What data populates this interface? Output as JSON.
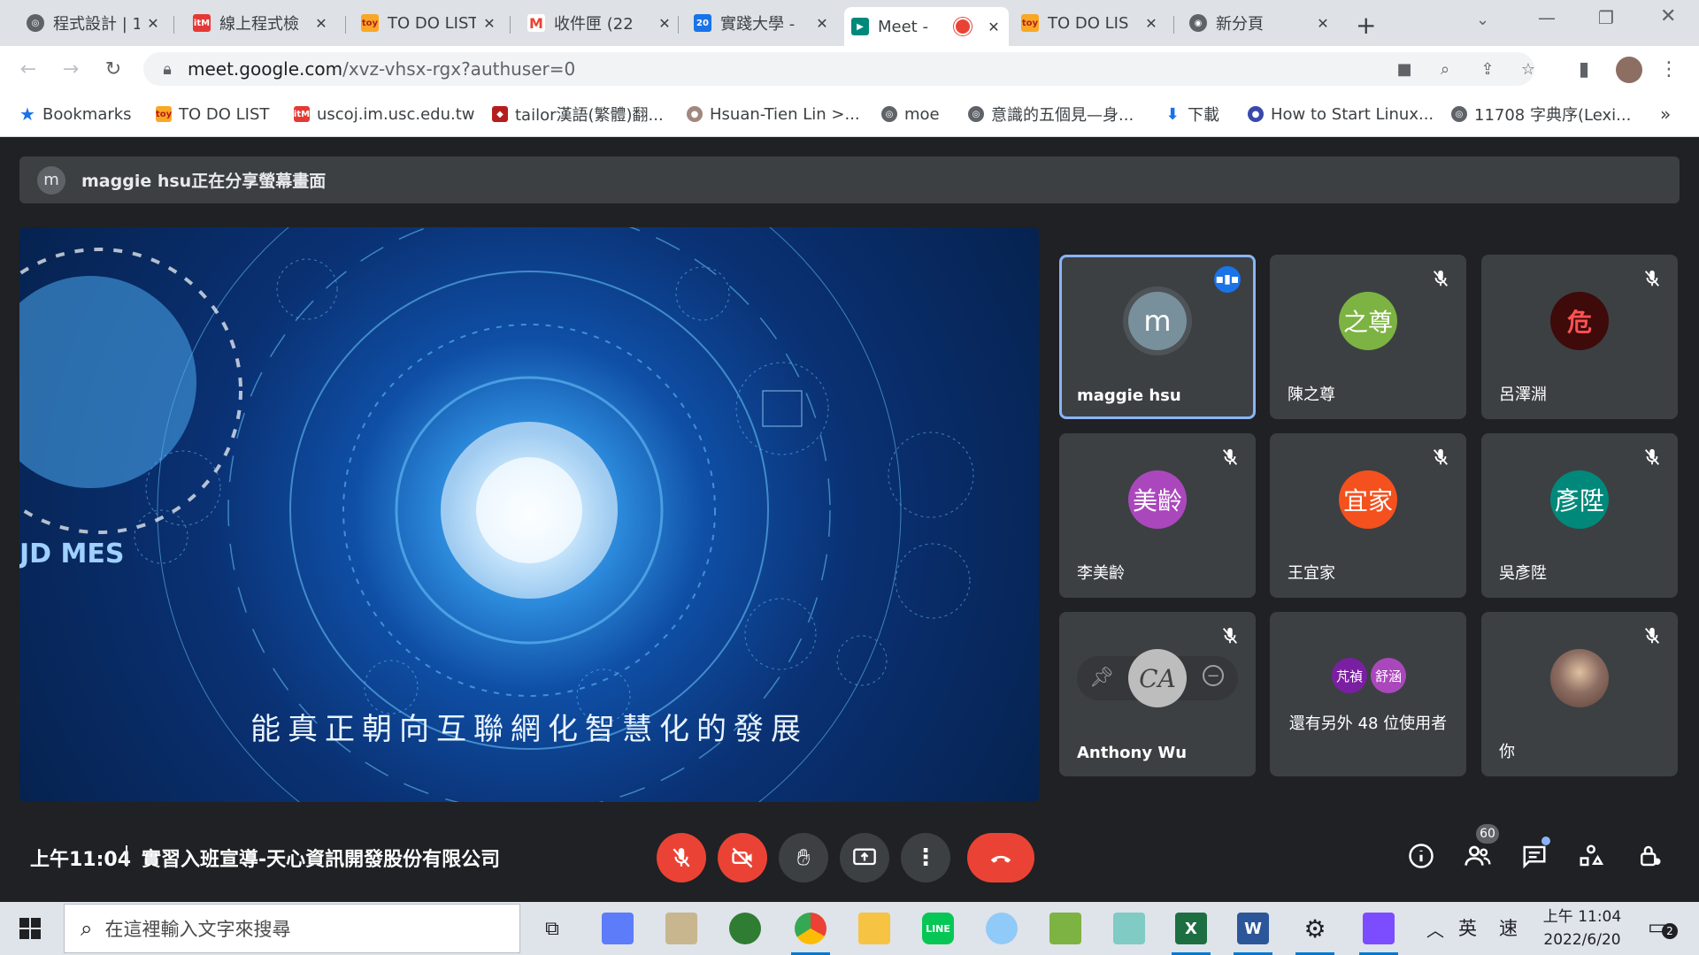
{
  "browser": {
    "tabs": [
      {
        "title": "程式設計 | 1",
        "icon": "globe-icon"
      },
      {
        "title": "線上程式檢",
        "icon": "itm-icon"
      },
      {
        "title": "TO DO LIST",
        "icon": "todo-icon"
      },
      {
        "title": "收件匣 (22",
        "icon": "gmail-icon"
      },
      {
        "title": "實踐大學 -",
        "icon": "calendar-icon"
      },
      {
        "title": "Meet -",
        "icon": "meet-icon"
      },
      {
        "title": "TO DO LIS",
        "icon": "todo-icon"
      },
      {
        "title": "新分頁",
        "icon": "chrome-icon"
      }
    ],
    "url_host": "meet.google.com",
    "url_path": "/xvz-vhsx-rgx?authuser=0",
    "bookmarks": [
      {
        "label": "Bookmarks"
      },
      {
        "label": "TO DO LIST"
      },
      {
        "label": "uscoj.im.usc.edu.tw"
      },
      {
        "label": "tailor漢語(繁體)翻..."
      },
      {
        "label": "Hsuan-Tien Lin >..."
      },
      {
        "label": "moe"
      },
      {
        "label": "意識的五個見—身..."
      },
      {
        "label": "下載"
      },
      {
        "label": "How to Start Linux..."
      },
      {
        "label": "11708 字典序(Lexi..."
      }
    ]
  },
  "meet": {
    "banner_avatar": "m",
    "banner_text": "maggie hsu正在分享螢幕畫面",
    "presentation_subtitle": "能真正朝向互聯網化智慧化的發展",
    "presentation_brand": "JD MES",
    "participants": [
      {
        "name": "maggie hsu",
        "initial": "m",
        "color": "#78909c",
        "speaking": true
      },
      {
        "name": "陳之尊",
        "initial": "之尊",
        "color": "#7cb342",
        "muted": true
      },
      {
        "name": "呂澤淵",
        "initial": "危",
        "color": "#b71c1c",
        "muted": true
      },
      {
        "name": "李美齡",
        "initial": "美齡",
        "color": "#ab47bc",
        "muted": true
      },
      {
        "name": "王宜家",
        "initial": "宜家",
        "color": "#f4511e",
        "muted": true
      },
      {
        "name": "吳彥陞",
        "initial": "彥陞",
        "color": "#00897b",
        "muted": true
      },
      {
        "name": "Anthony Wu",
        "initial": "CA",
        "color": "#bdbdbd",
        "muted": true
      },
      {
        "name": "還有另外 48 位使用者",
        "initial_a": "芃禎",
        "initial_b": "舒涵"
      },
      {
        "name": "你",
        "muted": true
      }
    ],
    "clock": "上午11:04",
    "meeting_title": "實習入班宣導-天心資訊開發股份有限公司",
    "people_count": "60"
  },
  "taskbar": {
    "search_placeholder": "在這裡輸入文字來搜尋",
    "ime_lang": "英",
    "ime_mode": "速",
    "time": "上午 11:04",
    "date": "2022/6/20",
    "notifications": "2"
  }
}
